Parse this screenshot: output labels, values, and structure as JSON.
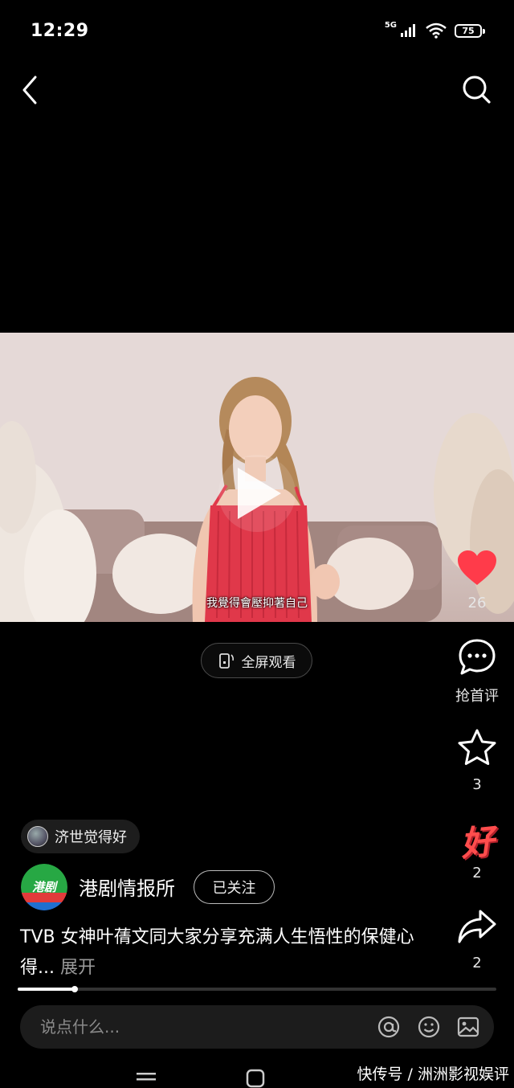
{
  "status_bar": {
    "time": "12:29",
    "network": "5G",
    "battery": "75"
  },
  "video": {
    "subtitle": "我覺得會壓抑著自己",
    "fullscreen_label": "全屏观看",
    "progress": 0.12
  },
  "actions": {
    "like_count": "26",
    "comment_label": "抢首评",
    "favorite_count": "3",
    "good_label": "好",
    "good_count": "2",
    "share_count": "2"
  },
  "user_tag": {
    "name": "济世觉得好"
  },
  "account": {
    "logo_text": "港剧",
    "name": "港剧情报所",
    "follow_label": "已关注"
  },
  "caption": {
    "text": "TVB 女神叶蒨文同大家分享充满人生悟性的保健心得...",
    "expand_label": "展开"
  },
  "comment_bar": {
    "placeholder": "说点什么..."
  },
  "watermark": "快传号 / 洲洲影视娱评",
  "colors": {
    "like": "#ff3b4a",
    "good": "#ff4d4d",
    "logo_green": "#27a844",
    "logo_red": "#e23b3b",
    "logo_blue": "#1f6fd0"
  }
}
